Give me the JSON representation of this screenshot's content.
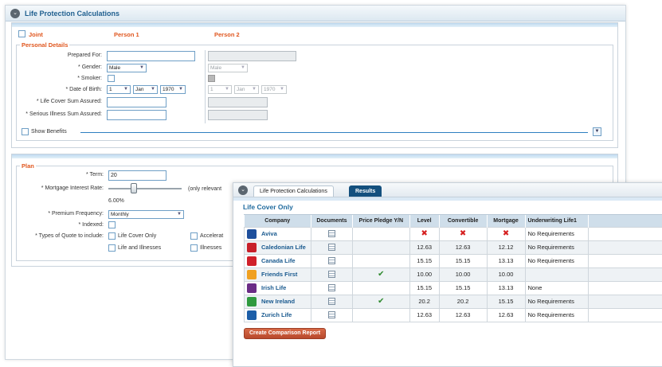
{
  "back_window": {
    "title": "Life Protection Calculations",
    "header": {
      "joint_label": "Joint",
      "person1": "Person 1",
      "person2": "Person 2"
    },
    "personal_details": {
      "legend": "Personal Details",
      "fields": {
        "prepared_for": {
          "label": "Prepared For:",
          "value": ""
        },
        "gender": {
          "label": "* Gender:",
          "p1": "Male",
          "p2": "Male"
        },
        "smoker": {
          "label": "* Smoker:"
        },
        "dob": {
          "label": "* Date of Birth:",
          "day": "1",
          "month": "Jan",
          "year": "1970"
        },
        "life_cover": {
          "label": "* Life Cover Sum Assured:",
          "value": ""
        },
        "serious_illness": {
          "label": "* Serious Illness Sum Assured:",
          "value": ""
        }
      },
      "show_benefits": "Show Benefits"
    },
    "plan": {
      "legend": "Plan",
      "term": {
        "label": "* Term:",
        "value": "20"
      },
      "mortgage_rate": {
        "label": "* Mortgage Interest Rate:",
        "value": "6.00%",
        "note": "(only relevant",
        "slider_fraction": 0.35
      },
      "premium_frequency": {
        "label": "* Premium Frequency:",
        "value": "Monthly"
      },
      "indexed": {
        "label": "* Indexed:"
      },
      "quote_types": {
        "label": "* Types of Quote to include:",
        "options": [
          "Life Cover Only",
          "Accelerat",
          "Life and Illnesses",
          "Illnesses"
        ]
      }
    }
  },
  "front_window": {
    "tabs": [
      "Life Protection Calculations",
      "Results"
    ],
    "heading": "Life Cover Only",
    "columns": [
      "Company",
      "Documents",
      "Price Pledge Y/N",
      "Level",
      "Convertible",
      "Mortgage",
      "Underwriting Life1"
    ],
    "rows": [
      {
        "company": "Aviva",
        "logo_color": "#1e4f9c",
        "pledge": false,
        "level": "x",
        "convertible": "x",
        "mortgage": "x",
        "underwriting": "No Requirements"
      },
      {
        "company": "Caledonian Life",
        "logo_color": "#c8202a",
        "pledge": false,
        "level": "12.63",
        "convertible": "12.63",
        "mortgage": "12.12",
        "underwriting": "No Requirements"
      },
      {
        "company": "Canada Life",
        "logo_color": "#d0202a",
        "pledge": false,
        "level": "15.15",
        "convertible": "15.15",
        "mortgage": "13.13",
        "underwriting": "No Requirements"
      },
      {
        "company": "Friends First",
        "logo_color": "#f0a020",
        "pledge": true,
        "level": "10.00",
        "convertible": "10.00",
        "mortgage": "10.00",
        "underwriting": ""
      },
      {
        "company": "Irish Life",
        "logo_color": "#6a2c86",
        "pledge": false,
        "level": "15.15",
        "convertible": "15.15",
        "mortgage": "13.13",
        "underwriting": "None"
      },
      {
        "company": "New Ireland",
        "logo_color": "#2f9a3f",
        "pledge": true,
        "level": "20.2",
        "convertible": "20.2",
        "mortgage": "15.15",
        "underwriting": "No Requirements"
      },
      {
        "company": "Zurich Life",
        "logo_color": "#1c5ea8",
        "pledge": false,
        "level": "12.63",
        "convertible": "12.63",
        "mortgage": "12.63",
        "underwriting": "No Requirements"
      }
    ],
    "report_button": "Create Comparison Report"
  },
  "colors": {
    "accent": "#1f5f8f",
    "orange": "#e0571f",
    "results_tab": "#14507e",
    "button": "#c4573a"
  }
}
